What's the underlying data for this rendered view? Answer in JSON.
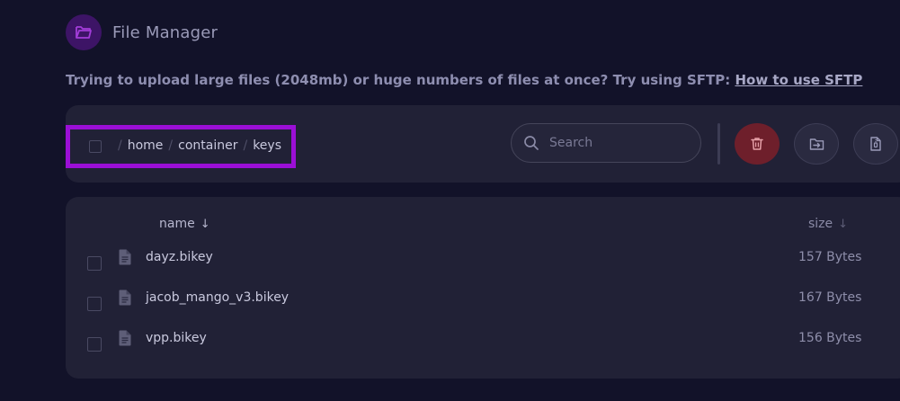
{
  "header": {
    "title": "File Manager",
    "icon": "folder-open-icon",
    "icon_color": "#a23cd8",
    "icon_bg": "#3d1466"
  },
  "notice": {
    "text": "Trying to upload large files (2048mb) or huge numbers of files at once? Try using SFTP:",
    "link_label": "How to use SFTP"
  },
  "toolbar": {
    "breadcrumb": [
      "home",
      "container",
      "keys"
    ],
    "highlight_color": "#9b0fd6",
    "search": {
      "placeholder": "Search",
      "value": ""
    },
    "buttons": [
      {
        "name": "delete",
        "icon": "trash-icon",
        "color": "#6e1f2b"
      },
      {
        "name": "move",
        "icon": "folder-move-icon"
      },
      {
        "name": "archive",
        "icon": "file-zip-icon"
      }
    ]
  },
  "table": {
    "columns": {
      "name": "name",
      "name_sort": "↓",
      "size": "size",
      "size_sort": "↓"
    },
    "files": [
      {
        "name": "dayz.bikey",
        "size": "157 Bytes"
      },
      {
        "name": "jacob_mango_v3.bikey",
        "size": "167 Bytes"
      },
      {
        "name": "vpp.bikey",
        "size": "156 Bytes"
      }
    ]
  }
}
